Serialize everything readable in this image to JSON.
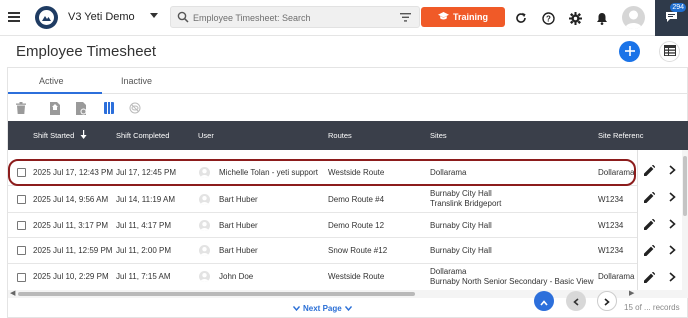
{
  "header": {
    "app_title": "V3 Yeti Demo",
    "search_placeholder": "Employee Timesheet: Search",
    "training_label": "Training",
    "chat_badge": "294",
    "icons": [
      "menu-icon",
      "app-logo",
      "chevron-down-icon",
      "search-icon",
      "filter-icon",
      "graduation-cap-icon",
      "refresh-icon",
      "help-icon",
      "gear-icon",
      "bell-icon",
      "avatar",
      "chat-icon"
    ]
  },
  "page": {
    "title": "Employee Timesheet"
  },
  "tabs": [
    {
      "label": "Active",
      "selected": true
    },
    {
      "label": "Inactive",
      "selected": false
    }
  ],
  "toolbar": {
    "icons": [
      "delete-icon",
      "export-icon",
      "import-icon",
      "column-view-icon",
      "hide-icon"
    ]
  },
  "table": {
    "columns": [
      "Shift Started",
      "Shift Completed",
      "User",
      "Routes",
      "Sites",
      "Site Referenc"
    ],
    "sort_column": "Shift Started",
    "rows": [
      {
        "started": "2025 Jul 17, 12:43 PM",
        "completed": "Jul 17, 12:45 PM",
        "user": "Michelle Tolan - yeti support",
        "route": "Westside Route",
        "sites": [
          "Dollarama"
        ],
        "site_ref": "Dollarama",
        "highlighted": true
      },
      {
        "started": "2025 Jul 14, 9:56 AM",
        "completed": "Jul 14, 11:19 AM",
        "user": "Bart Huber",
        "route": "Demo Route #4",
        "sites": [
          "Burnaby City Hall",
          "Translink Bridgeport"
        ],
        "site_ref": "W1234",
        "highlighted": false
      },
      {
        "started": "2025 Jul 11, 3:17 PM",
        "completed": "Jul 11, 4:17 PM",
        "user": "Bart Huber",
        "route": "Demo Route 12",
        "sites": [
          "Burnaby City Hall"
        ],
        "site_ref": "W1234",
        "highlighted": false
      },
      {
        "started": "2025 Jul 11, 12:59 PM",
        "completed": "Jul 11, 2:00 PM",
        "user": "Bart Huber",
        "route": "Snow Route #12",
        "sites": [
          "Burnaby City Hall"
        ],
        "site_ref": "W1234",
        "highlighted": false
      },
      {
        "started": "2025 Jul 10, 2:29 PM",
        "completed": "Jul 11, 7:15 AM",
        "user": "John Doe",
        "route": "Westside Route",
        "sites": [
          "Dollarama",
          "Burnaby North Senior Secondary - Basic View"
        ],
        "site_ref": "Dollarama",
        "highlighted": false
      }
    ]
  },
  "pagination": {
    "next_page_label": "Next Page",
    "records_label": "15 of ... records"
  },
  "colors": {
    "topbar_accent": "#f05a28",
    "primary": "#1a73e8",
    "table_header": "#3a3f4a",
    "highlight_outline": "#8c1c1c"
  }
}
